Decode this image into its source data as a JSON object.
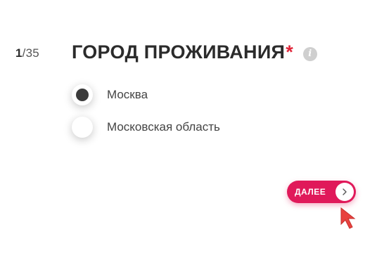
{
  "progress": {
    "current": "1",
    "total": "/35"
  },
  "question": {
    "title": "ГОРОД ПРОЖИВАНИЯ",
    "required_marker": "*",
    "info_icon": "info-icon"
  },
  "options": [
    {
      "label": "Москва",
      "selected": true
    },
    {
      "label": "Московская область",
      "selected": false
    }
  ],
  "next_button": {
    "label": "ДАЛЕЕ",
    "icon": "chevron-right-icon"
  },
  "colors": {
    "accent": "#e0195a",
    "required": "#e0263a",
    "text": "#2b2b2b"
  }
}
